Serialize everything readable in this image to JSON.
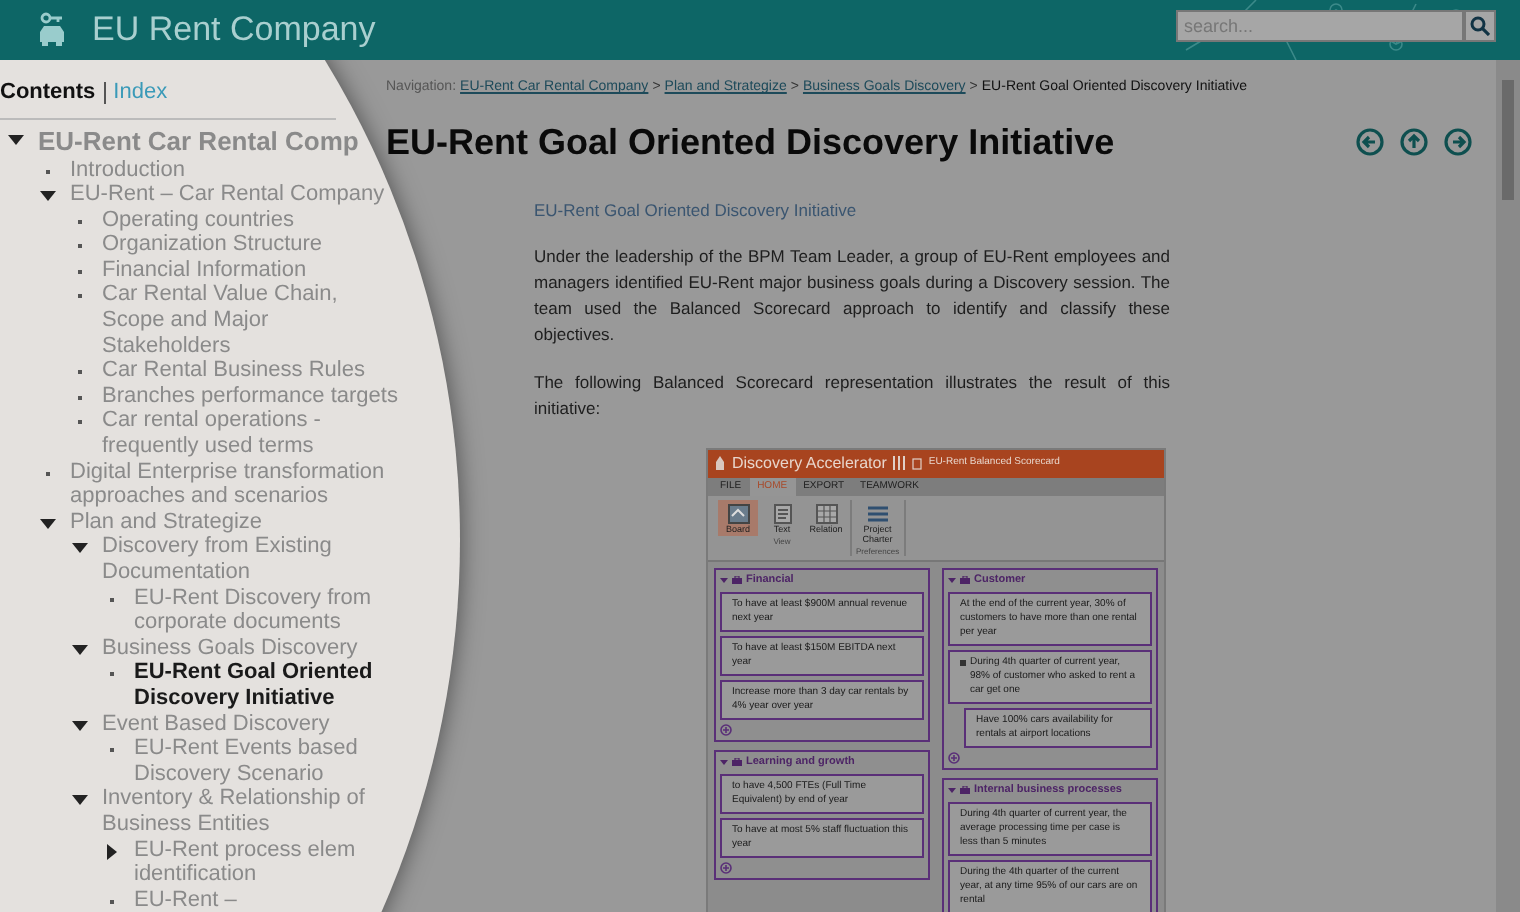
{
  "header": {
    "title": "EU Rent Company",
    "search": {
      "placeholder": "search..."
    }
  },
  "sidebar_tabs": [
    {
      "label": "Contents",
      "selected": true
    },
    {
      "label": "Index",
      "selected": false
    }
  ],
  "toc": [
    {
      "label": "EU-Rent Car Rental Comp",
      "kind": "folder",
      "expanded": true,
      "selected": false,
      "children": [
        {
          "label": "Introduction",
          "kind": "page",
          "selected": false
        },
        {
          "label": "EU-Rent – Car Rental Company",
          "kind": "folder",
          "expanded": true,
          "selected": false,
          "children": [
            {
              "label": "Operating countries",
              "kind": "page",
              "selected": false
            },
            {
              "label": "Organization Structure",
              "kind": "page",
              "selected": false
            },
            {
              "label": "Financial Information",
              "kind": "page",
              "selected": false
            },
            {
              "label": "Car Rental Value Chain, Scope and Major Stakeholders",
              "kind": "page",
              "selected": false
            },
            {
              "label": "Car Rental Business Rules",
              "kind": "page",
              "selected": false
            },
            {
              "label": "Branches performance targets",
              "kind": "page",
              "selected": false
            },
            {
              "label": "Car rental operations - frequently used terms",
              "kind": "page",
              "selected": false
            }
          ]
        },
        {
          "label": "Digital Enterprise transformation approaches and scenarios",
          "kind": "page",
          "selected": false
        },
        {
          "label": "Plan and Strategize",
          "kind": "folder",
          "expanded": true,
          "selected": false,
          "children": [
            {
              "label": "Discovery from Existing Documentation",
              "kind": "folder",
              "expanded": true,
              "selected": false,
              "children": [
                {
                  "label": "EU-Rent Discovery from corporate documents",
                  "kind": "page",
                  "selected": false
                }
              ]
            },
            {
              "label": "Business Goals Discovery",
              "kind": "folder",
              "expanded": true,
              "selected": false,
              "children": [
                {
                  "label": "EU-Rent Goal Oriented Discovery Initiative",
                  "kind": "page",
                  "selected": true
                }
              ]
            },
            {
              "label": "Event Based Discovery",
              "kind": "folder",
              "expanded": true,
              "selected": false,
              "children": [
                {
                  "label": "EU-Rent Events based Discovery Scenario",
                  "kind": "page",
                  "selected": false
                }
              ]
            },
            {
              "label": "Inventory & Relationship of Business Entities",
              "kind": "folder",
              "expanded": true,
              "selected": false,
              "children": [
                {
                  "label": "EU-Rent process elem identification",
                  "kind": "folder",
                  "expanded": false,
                  "selected": false
                },
                {
                  "label": "EU-Rent –",
                  "kind": "page",
                  "selected": false
                }
              ]
            }
          ]
        }
      ]
    }
  ],
  "breadcrumb": {
    "label": "Navigation:",
    "separator": ">",
    "links": [
      "EU-Rent Car Rental Company",
      "Plan and Strategize",
      "Business Goals Discovery"
    ],
    "current": "EU-Rent Goal Oriented Discovery Initiative"
  },
  "page": {
    "title": "EU-Rent Goal Oriented Discovery Initiative",
    "subtitle": "EU-Rent Goal Oriented Discovery Initiative",
    "paragraphs": [
      "Under the leadership of the BPM Team Leader, a group of EU-Rent employees and managers identified EU-Rent major business goals during a Discovery session. The team used the Balanced Scorecard approach to identify and classify these objectives.",
      "The following Balanced Scorecard representation illustrates the result of this initiative:"
    ]
  },
  "embedded_app": {
    "app_title": "Discovery Accelerator",
    "document_title": "EU-Rent Balanced Scorecard",
    "menu": [
      {
        "label": "FILE",
        "selected": false
      },
      {
        "label": "HOME",
        "selected": true
      },
      {
        "label": "EXPORT",
        "selected": false
      },
      {
        "label": "TEAMWORK",
        "selected": false
      }
    ],
    "ribbon_groups": [
      {
        "label": "View",
        "buttons": [
          {
            "label": "Board",
            "selected": true
          },
          {
            "label": "Text",
            "selected": false
          },
          {
            "label": "Relation",
            "selected": false
          }
        ]
      },
      {
        "label": "Preferences",
        "buttons": [
          {
            "label": "Project Charter",
            "selected": false
          }
        ]
      }
    ],
    "columns": [
      [
        {
          "title": "Financial",
          "goals": [
            {
              "text": "To have at least $900M annual revenue next year"
            },
            {
              "text": "To have at least $150M EBITDA next year"
            },
            {
              "text": "Increase more than 3 day car rentals by 4% year over year"
            }
          ]
        },
        {
          "title": "Learning and growth",
          "goals": [
            {
              "text": "to have 4,500 FTEs (Full Time Equivalent) by end of year"
            },
            {
              "text": "To have at most 5% staff fluctuation this year"
            }
          ]
        }
      ],
      [
        {
          "title": "Customer",
          "goals": [
            {
              "text": "At the end of the current year, 30% of customers to have more than one rental per year"
            },
            {
              "text": "During 4th quarter of current year, 98% of customer who asked to rent a car get one",
              "children": [
                {
                  "text": "Have 100% cars availability for rentals at airport locations"
                }
              ]
            }
          ]
        },
        {
          "title": "Internal business processes",
          "goals": [
            {
              "text": "During 4th quarter of current year, the average processing time per case is less than 5 minutes"
            },
            {
              "text": "During the 4th quarter of the current year, at any time 95% of our cars are on rental"
            }
          ]
        }
      ]
    ]
  }
}
